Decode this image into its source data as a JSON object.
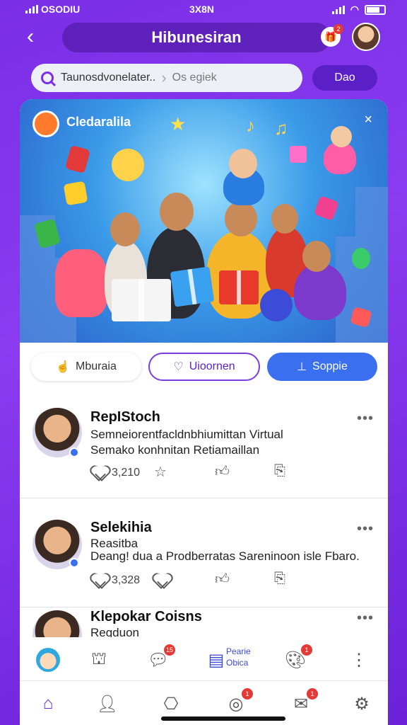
{
  "status_bar": {
    "carrier": "OSODIU",
    "time": "3X8N"
  },
  "header": {
    "title": "Hibunesiran",
    "gift_badge": "2"
  },
  "search": {
    "query": "Taunosdvonelater..",
    "hint": "Os egiek",
    "button": "Dao"
  },
  "banner": {
    "brand": "Cledaralila",
    "close": "×"
  },
  "chips": [
    {
      "label": "Mburaia",
      "icon": "hand-icon"
    },
    {
      "label": "Uioornen",
      "icon": "heart-outline-icon"
    },
    {
      "label": "Soppie",
      "icon": "upload-icon"
    }
  ],
  "posts": [
    {
      "name": "RepIStoch",
      "lines": [
        "Semneiorentfacldnbhiumittan Virtual",
        "Semako konhnitan Retiamaillan"
      ],
      "likes": "3,210",
      "more": "•••"
    },
    {
      "name": "Selekihia",
      "lines": [
        "Reasitba",
        "Deang! dua a Prodberratas Sareninoon isle Fbaro."
      ],
      "likes": "3,328",
      "more": "•••"
    },
    {
      "name": "Klepokar Coisns",
      "lines": [
        "Regduon"
      ],
      "more": "•••"
    }
  ],
  "toolbar": {
    "chat_badge": "15",
    "mid_label_1": "Pearie",
    "mid_label_2": "Obica",
    "paint_badge": "1"
  },
  "nav": {
    "badge_a": "1",
    "badge_b": "1"
  },
  "colors": {
    "accent": "#7a2ee6",
    "primary_blue": "#3a6ff0",
    "badge_red": "#e53935"
  }
}
